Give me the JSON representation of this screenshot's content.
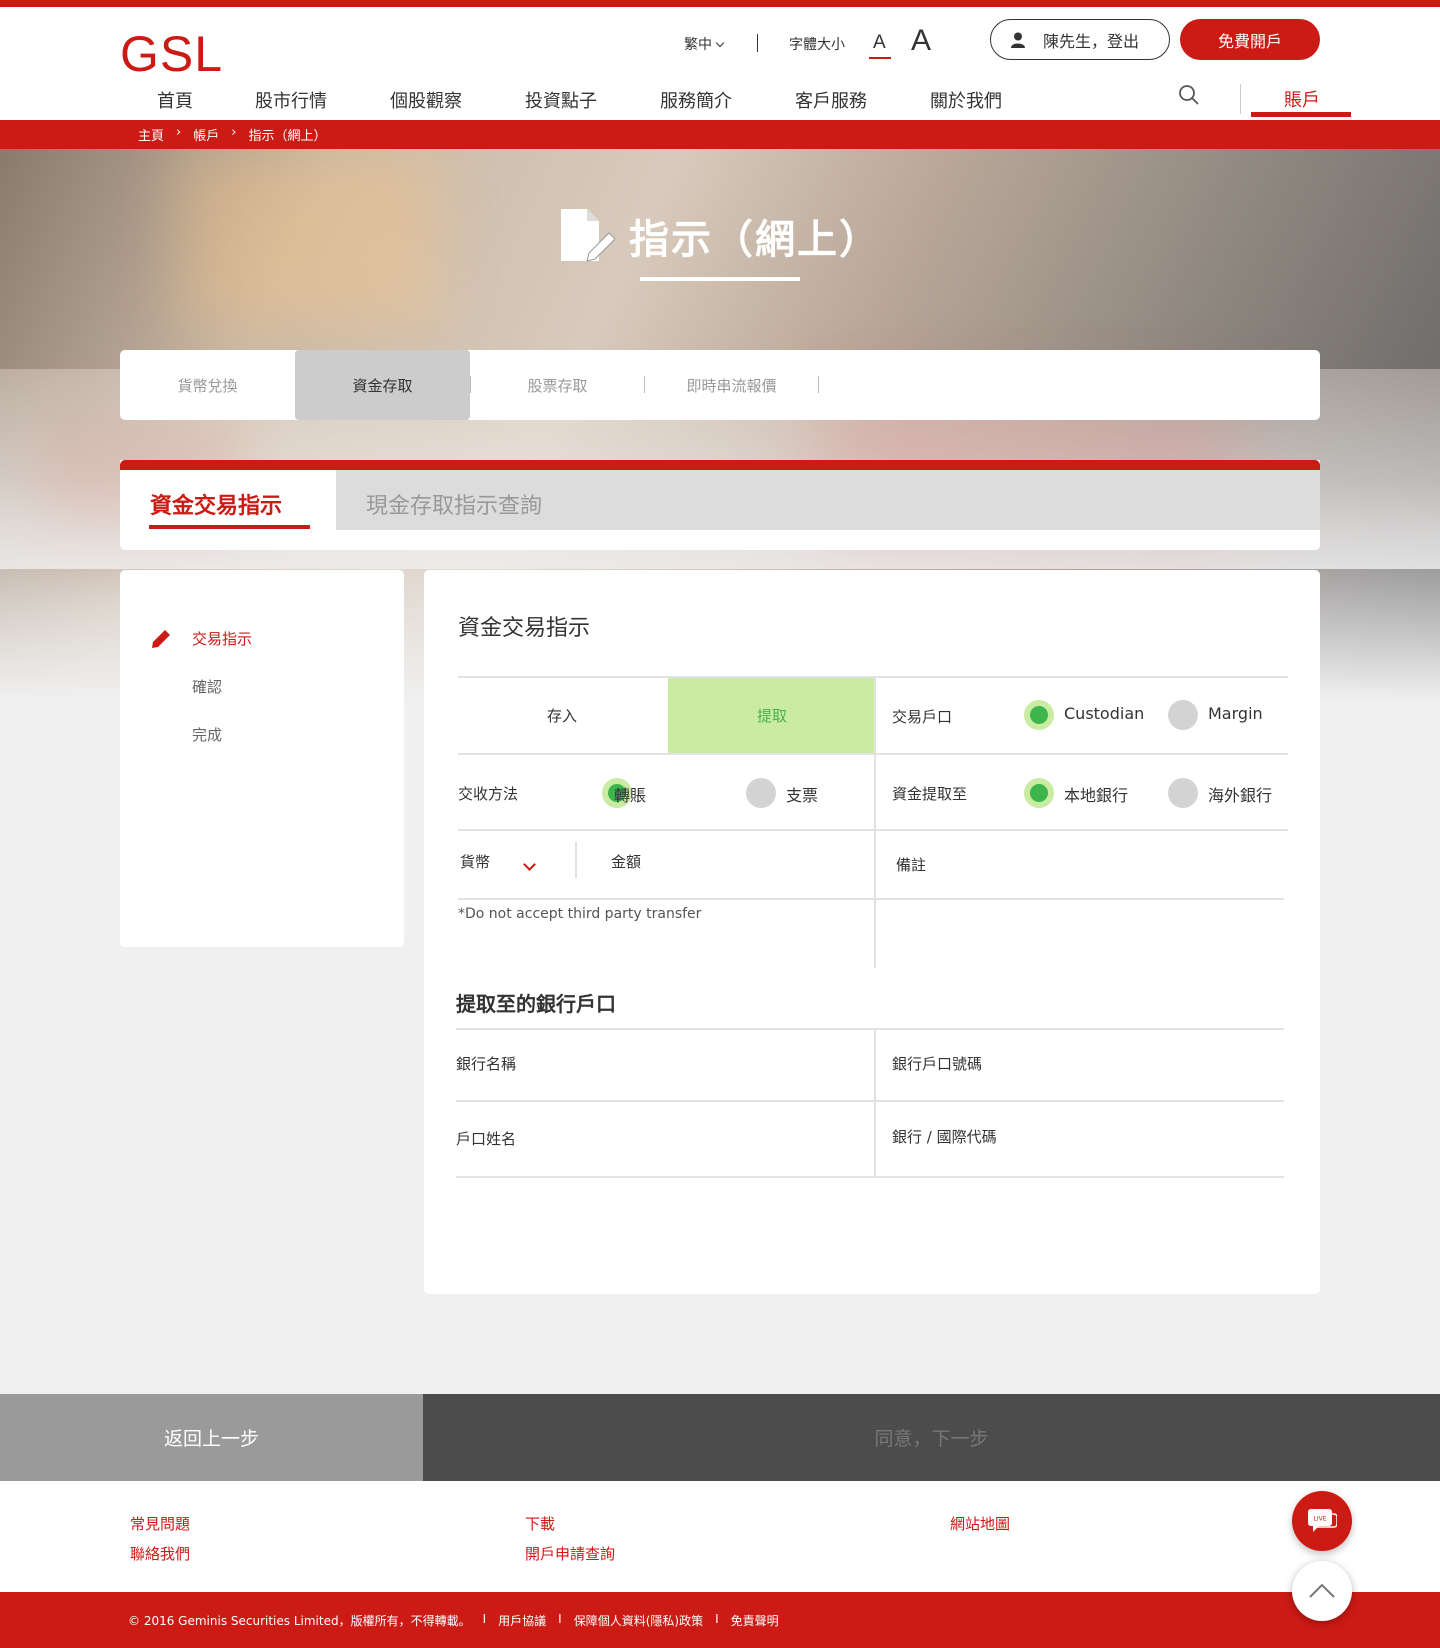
{
  "header": {
    "logo": "GSL",
    "language": "繁中",
    "font_size_label": "字體大小",
    "font_small": "A",
    "font_large": "A",
    "user_label": "陳先生，登出",
    "open_account": "免費開戶"
  },
  "nav": {
    "items": [
      "首頁",
      "股市行情",
      "個股觀察",
      "投資點子",
      "服務簡介",
      "客戶服務",
      "關於我們"
    ],
    "account": "賬戶"
  },
  "breadcrumb": [
    "主頁",
    "›",
    "帳戶",
    "›",
    "指示（網上）"
  ],
  "hero": {
    "title": "指示（網上）"
  },
  "subtabs": [
    "貨幣兌換",
    "資金存取",
    "股票存取",
    "即時串流報價"
  ],
  "main_tabs": {
    "active": "資金交易指示",
    "inactive": "現金存取指示查詢"
  },
  "sidebar": {
    "items": [
      "交易指示",
      "確認",
      "完成"
    ]
  },
  "form": {
    "title": "資金交易指示",
    "deposit": "存入",
    "withdraw": "提取",
    "trade_account_label": "交易戶口",
    "account_options": [
      "Custodian",
      "Margin"
    ],
    "settlement_label": "交收方法",
    "settlement_options": [
      "轉賬",
      "支票"
    ],
    "withdraw_to_label": "資金提取至",
    "withdraw_to_options": [
      "本地銀行",
      "海外銀行"
    ],
    "currency_label": "貨幣",
    "amount_label": "金額",
    "remarks_label": "備註",
    "note": "*Do not accept third party transfer",
    "bank_section_title": "提取至的銀行戶口",
    "bank_name_label": "銀行名稱",
    "bank_account_no_label": "銀行戶口號碼",
    "account_name_label": "戶口姓名",
    "bank_code_label": "銀行 / 國際代碼"
  },
  "footer": {
    "back": "返回上一步",
    "next": "同意，下一步",
    "links": [
      "常見問題",
      "聯絡我們",
      "下載",
      "開戶申請查詢",
      "網站地圖"
    ],
    "copyright": [
      "© 2016 Geminis Securities Limited，版權所有，不得轉載。",
      "I",
      "用戶協議",
      "I",
      "保障個人資料(隱私)政策",
      "I",
      "免責聲明"
    ],
    "live": "LIVE"
  },
  "colors": {
    "brand": "#cc1a14",
    "selected_green": "#3cb54a",
    "withdraw_bg": "#c9eca2"
  }
}
